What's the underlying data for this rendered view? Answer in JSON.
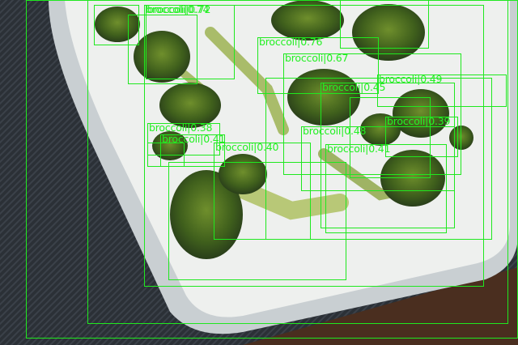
{
  "image": {
    "description_class": "broccoli",
    "box_color": "#1fe81f"
  },
  "detections": [
    {
      "label": "broccoli",
      "score": "0.72",
      "text": "broccoli|0.72"
    },
    {
      "label": "broccoli",
      "score": "0.76",
      "text": "broccoli|0.76"
    },
    {
      "label": "broccoli",
      "score": "0.67",
      "text": "broccoli|0.67"
    },
    {
      "label": "broccoli",
      "score": "0.49",
      "text": "broccoli|0.49"
    },
    {
      "label": "broccoli",
      "score": "0.48",
      "text": "broccoli|0.48"
    },
    {
      "label": "broccoli",
      "score": "0.41",
      "text": "broccoli|0.41"
    },
    {
      "label": "broccoli",
      "score": "0.39",
      "text": "broccoli|0.39"
    },
    {
      "label": "broccoli",
      "score": "0.38",
      "text": "broccoli|0.38"
    },
    {
      "label": "broccoli",
      "score": "0.45",
      "text": "broccoli|0.45"
    },
    {
      "label": "broccoli",
      "score": "0.40",
      "text": "broccoli|0.40"
    },
    {
      "label": "broccoli",
      "score": "0.41",
      "text": "broccoli|0.41"
    },
    {
      "label": "broccoli",
      "score": "0.74",
      "text": "broccoli|0.74"
    }
  ]
}
